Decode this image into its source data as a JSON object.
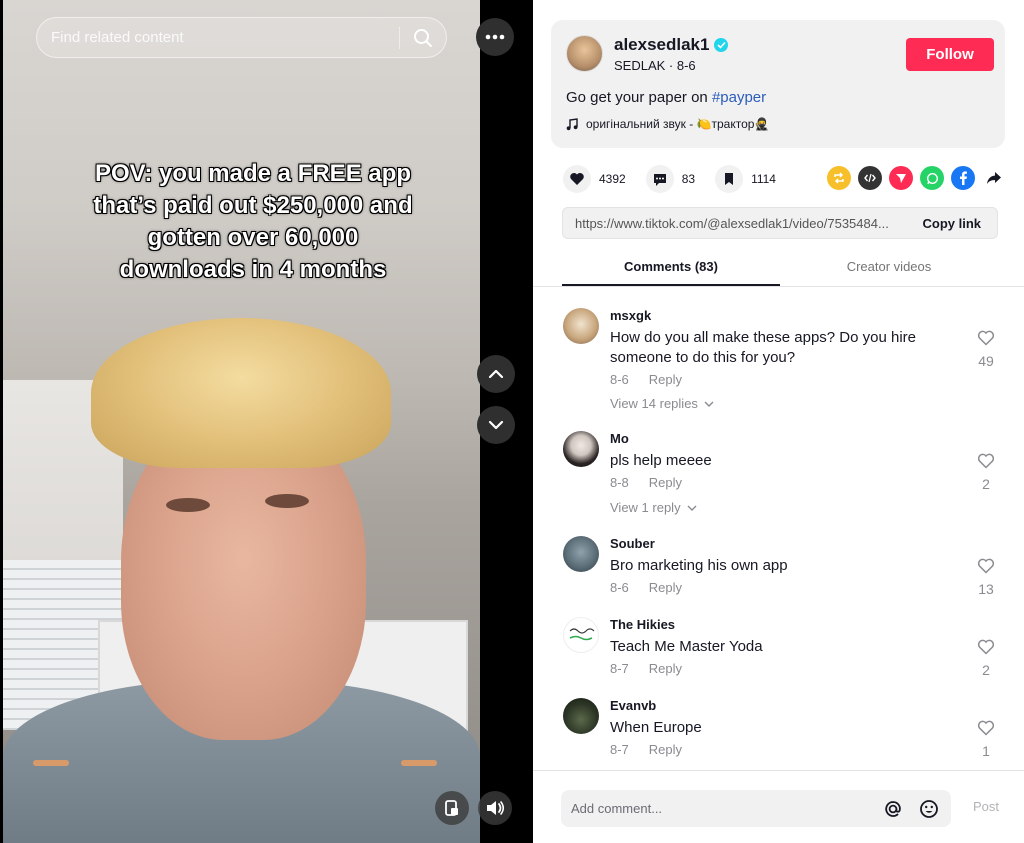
{
  "search": {
    "placeholder": "Find related content"
  },
  "video": {
    "overlay_lines": [
      "POV: you made a FREE app",
      "that’s paid out $250,000 and",
      "gotten over 60,000",
      "downloads in 4 months"
    ]
  },
  "author": {
    "username": "alexsedlak1",
    "subtitle": "SEDLAK · 8-6",
    "follow_label": "Follow",
    "description_prefix": "Go get your paper on ",
    "description_tag": "#payper",
    "music": "оригінальний звук - 🍋трактор🥷"
  },
  "stats": {
    "likes": "4392",
    "comments": "83",
    "saves": "1114"
  },
  "share_colors": [
    "#f7c02a",
    "#333333",
    "#fe2c55",
    "#25d366",
    "#1877f2",
    "#161823"
  ],
  "link": {
    "url": "https://www.tiktok.com/@alexsedlak1/video/7535484...",
    "copy_label": "Copy link"
  },
  "tabs": [
    {
      "label": "Comments (83)"
    },
    {
      "label": "Creator videos"
    }
  ],
  "comments": [
    {
      "user": "msxgk",
      "text": "How do you all make these apps? Do you hire someone to do this for you?",
      "date": "8-6",
      "reply": "Reply",
      "replies": "View 14 replies",
      "likes": "49"
    },
    {
      "user": "Mo",
      "text": "pls help meeee",
      "date": "8-8",
      "reply": "Reply",
      "replies": "View 1 reply",
      "likes": "2"
    },
    {
      "user": "Souber",
      "text": "Bro marketing his own app",
      "date": "8-6",
      "reply": "Reply",
      "replies": "",
      "likes": "13"
    },
    {
      "user": "The Hikies",
      "text": "Teach Me Master Yoda",
      "date": "8-7",
      "reply": "Reply",
      "replies": "",
      "likes": "2"
    },
    {
      "user": "Evanvb",
      "text": "When Europe",
      "date": "8-7",
      "reply": "Reply",
      "replies": "",
      "likes": "1"
    }
  ],
  "composer": {
    "placeholder": "Add comment...",
    "post_label": "Post"
  }
}
